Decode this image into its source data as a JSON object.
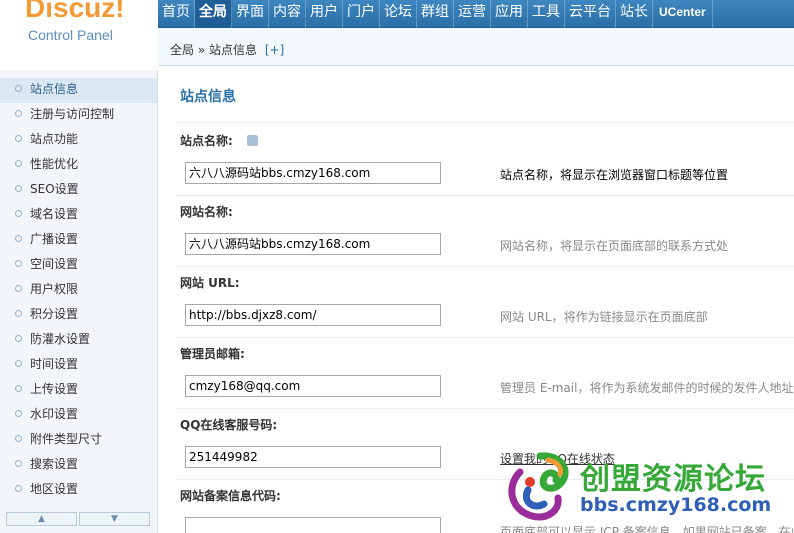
{
  "logo": {
    "brand": "Discuz!",
    "subtitle": "Control Panel"
  },
  "topnav": {
    "items": [
      {
        "label": "首页"
      },
      {
        "label": "全局",
        "active": true
      },
      {
        "label": "界面"
      },
      {
        "label": "内容"
      },
      {
        "label": "用户"
      },
      {
        "label": "门户"
      },
      {
        "label": "论坛"
      },
      {
        "label": "群组"
      },
      {
        "label": "运营"
      },
      {
        "label": "应用"
      },
      {
        "label": "工具"
      },
      {
        "label": "云平台"
      },
      {
        "label": "站长"
      },
      {
        "label": "UCenter"
      }
    ]
  },
  "breadcrumb": {
    "root": "全局",
    "separator": "»",
    "current": "站点信息",
    "add": "[+]"
  },
  "sidebar": {
    "items": [
      {
        "label": "站点信息",
        "active": true
      },
      {
        "label": "注册与访问控制"
      },
      {
        "label": "站点功能"
      },
      {
        "label": "性能优化"
      },
      {
        "label": "SEO设置"
      },
      {
        "label": "域名设置"
      },
      {
        "label": "广播设置"
      },
      {
        "label": "空间设置"
      },
      {
        "label": "用户权限"
      },
      {
        "label": "积分设置"
      },
      {
        "label": "防灌水设置"
      },
      {
        "label": "时间设置"
      },
      {
        "label": "上传设置"
      },
      {
        "label": "水印设置"
      },
      {
        "label": "附件类型尺寸"
      },
      {
        "label": "搜索设置"
      },
      {
        "label": "地区设置"
      }
    ],
    "scroll_up": "▲",
    "scroll_down": "▼"
  },
  "main": {
    "title": "站点信息",
    "fields": [
      {
        "label": "站点名称:",
        "value": "六八八源码站bbs.cmzy168.com",
        "hint": "站点名称，将显示在浏览器窗口标题等位置"
      },
      {
        "label": "网站名称:",
        "value": "六八八源码站bbs.cmzy168.com",
        "hint": "网站名称，将显示在页面底部的联系方式处"
      },
      {
        "label": "网站 URL:",
        "value": "http://bbs.djxz8.com/",
        "hint": "网站 URL，将作为链接显示在页面底部"
      },
      {
        "label": "管理员邮箱:",
        "value": "cmzy168@qq.com",
        "hint": "管理员 E-mail，将作为系统发邮件的时候的发件人地址"
      },
      {
        "label": "QQ在线客服号码:",
        "value": "251449982",
        "hint": "设置我的QQ在线状态"
      },
      {
        "label": "网站备案信息代码:",
        "value": "",
        "hint": "页面底部可以显示 ICP 备案信息，如果网站已备案，在此"
      }
    ]
  },
  "watermark": {
    "title": "创盟资源论坛",
    "url": "bbs.cmzy168.com"
  },
  "colors": {
    "nav": "#2a6fa8",
    "accent": "#f29a34",
    "wm_green": "#35a838",
    "wm_blue": "#2f5fb6"
  }
}
